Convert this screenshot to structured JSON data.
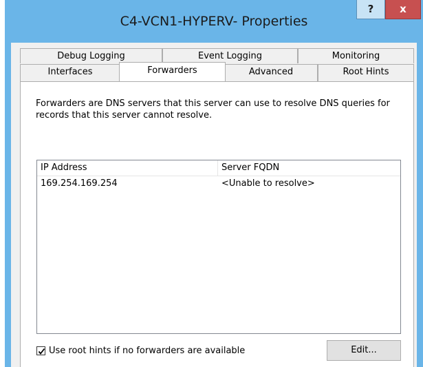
{
  "window": {
    "title": "C4-VCN1-HYPERV- Properties",
    "help_label": "?",
    "close_label": "x"
  },
  "tabs_row1": [
    {
      "label": "Debug Logging"
    },
    {
      "label": "Event Logging"
    },
    {
      "label": "Monitoring"
    }
  ],
  "tabs_row2": [
    {
      "label": "Interfaces"
    },
    {
      "label": "Forwarders",
      "active": true
    },
    {
      "label": "Advanced"
    },
    {
      "label": "Root Hints"
    }
  ],
  "forwarders": {
    "description": "Forwarders are DNS servers that this server can use to resolve DNS queries for records that this server cannot resolve.",
    "columns": {
      "ip": "IP Address",
      "fqdn": "Server FQDN"
    },
    "rows": [
      {
        "ip": "169.254.169.254",
        "fqdn": "<Unable to resolve>"
      }
    ],
    "use_root_hints_label": "Use root hints if no forwarders are available",
    "use_root_hints_checked": true,
    "edit_label": "Edit..."
  }
}
